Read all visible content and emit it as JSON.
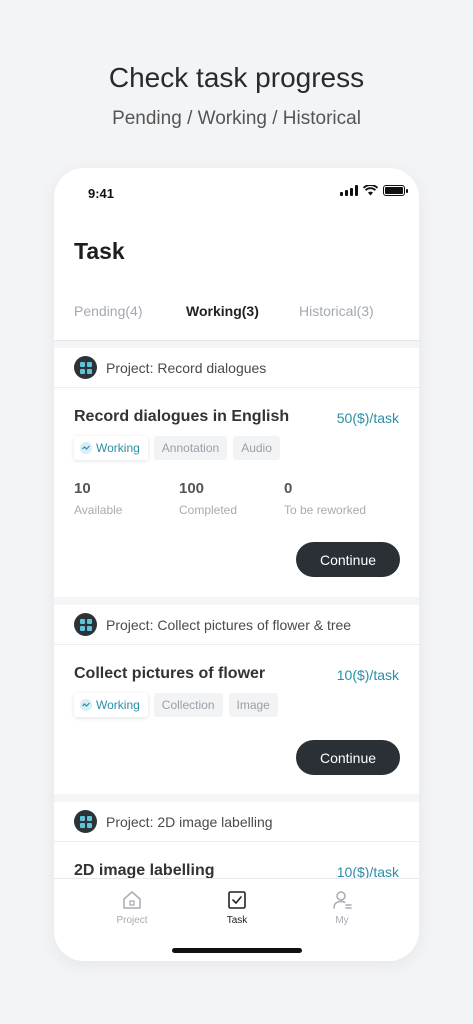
{
  "hero": {
    "title": "Check task progress",
    "subtitle": "Pending / Working / Historical"
  },
  "status_bar": {
    "time": "9:41"
  },
  "page": {
    "title": "Task"
  },
  "tabs": [
    {
      "label": "Pending(4)",
      "active": false
    },
    {
      "label": "Working(3)",
      "active": true
    },
    {
      "label": "Historical(3)",
      "active": false
    }
  ],
  "cards": [
    {
      "project": "Project: Record dialogues",
      "task": "Record dialogues in English",
      "price": "50($)/task",
      "status": "Working",
      "tags": [
        "Annotation",
        "Audio"
      ],
      "stats": [
        {
          "value": "10",
          "label": "Available"
        },
        {
          "value": "100",
          "label": "Completed"
        },
        {
          "value": "0",
          "label": "To be reworked"
        }
      ],
      "action": "Continue"
    },
    {
      "project": "Project: Collect pictures of flower & tree",
      "task": "Collect pictures of flower",
      "price": "10($)/task",
      "status": "Working",
      "tags": [
        "Collection",
        "Image"
      ],
      "action": "Continue"
    },
    {
      "project": "Project: 2D image labelling",
      "task": "2D image labelling",
      "price": "10($)/task"
    }
  ],
  "tabbar": [
    {
      "label": "Project",
      "icon": "home-icon",
      "active": false
    },
    {
      "label": "Task",
      "icon": "task-check-icon",
      "active": true
    },
    {
      "label": "My",
      "icon": "user-icon",
      "active": false
    }
  ],
  "colors": {
    "accent": "#2a8fa6",
    "button_dark": "#2a3036",
    "background": "#f3f4f6"
  }
}
